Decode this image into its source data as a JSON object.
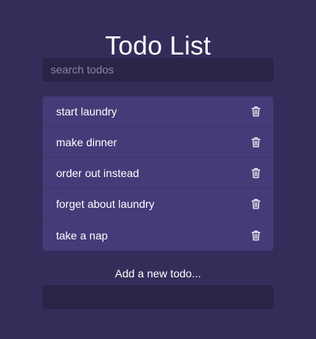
{
  "title": "Todo List",
  "search": {
    "placeholder": "search todos",
    "value": ""
  },
  "todos": [
    {
      "label": "start laundry",
      "icon": "trash-icon"
    },
    {
      "label": "make dinner",
      "icon": "trash-icon"
    },
    {
      "label": "order out instead",
      "icon": "trash-icon"
    },
    {
      "label": "forget about laundry",
      "icon": "trash-icon"
    },
    {
      "label": "take a nap",
      "icon": "trash-icon"
    }
  ],
  "add": {
    "label": "Add a new todo...",
    "value": ""
  },
  "colors": {
    "background": "#352c5a",
    "input_background": "#2a2447",
    "list_background": "#453b78",
    "text": "#ffffff"
  }
}
